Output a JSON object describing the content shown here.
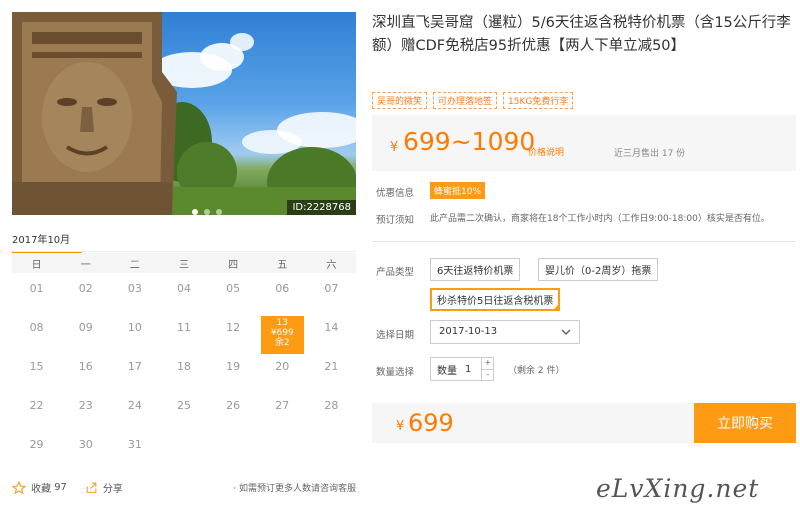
{
  "photo": {
    "id_label": "ID:2228768",
    "dots": 3,
    "active_dot": 0
  },
  "calendar": {
    "month_label": "2017年10月",
    "weekdays": [
      "日",
      "一",
      "二",
      "三",
      "四",
      "五",
      "六"
    ],
    "days": [
      "01",
      "02",
      "03",
      "04",
      "05",
      "06",
      "07",
      "08",
      "09",
      "10",
      "11",
      "12",
      "13",
      "14",
      "15",
      "16",
      "17",
      "18",
      "19",
      "20",
      "21",
      "22",
      "23",
      "24",
      "25",
      "26",
      "27",
      "28",
      "29",
      "30",
      "31"
    ],
    "selected": {
      "day": "13",
      "price": "¥699",
      "remain": "余2"
    }
  },
  "footer_actions": {
    "favorite_label": "收藏",
    "favorite_count": "97",
    "share_label": "分享",
    "consult_text": "· 如需预订更多人数请咨询客服"
  },
  "product": {
    "title": "深圳直飞吴哥窟（暹粒）5/6天往返含税特价机票（含15公斤行李额）赠CDF免税店95折优惠【两人下单立减50】",
    "tags": [
      "吴哥的微笑",
      "可办理落地签",
      "15KG免费行李"
    ],
    "price": {
      "yen": "¥",
      "range": "699~1090",
      "note": "价格说明",
      "sold": "近三月售出 17 份"
    },
    "discount": {
      "label": "优惠信息",
      "badge": "蜂蜜抵10%"
    },
    "notice": {
      "label": "预订须知",
      "text": "此产品需二次确认，商家将在18个工作小时内（工作日9:00-18:00）核实是否有位。"
    },
    "type": {
      "label": "产品类型",
      "options": [
        "6天往返特价机票",
        "婴儿价（0-2周岁）拖票",
        "秒杀特价5日往返含税机票"
      ],
      "selected_index": 2
    },
    "date": {
      "label": "选择日期",
      "value": "2017-10-13"
    },
    "quantity": {
      "label": "数量选择",
      "field_label": "数量",
      "value": "1",
      "plus": "+",
      "minus": "-",
      "remain": "（剩余 2 件）"
    },
    "total": {
      "yen": "¥",
      "amount": "699"
    },
    "buy_label": "立即购买"
  },
  "watermark": "eLvXing.net",
  "colors": {
    "accent": "#ff9b13",
    "price": "#ff7a00"
  }
}
